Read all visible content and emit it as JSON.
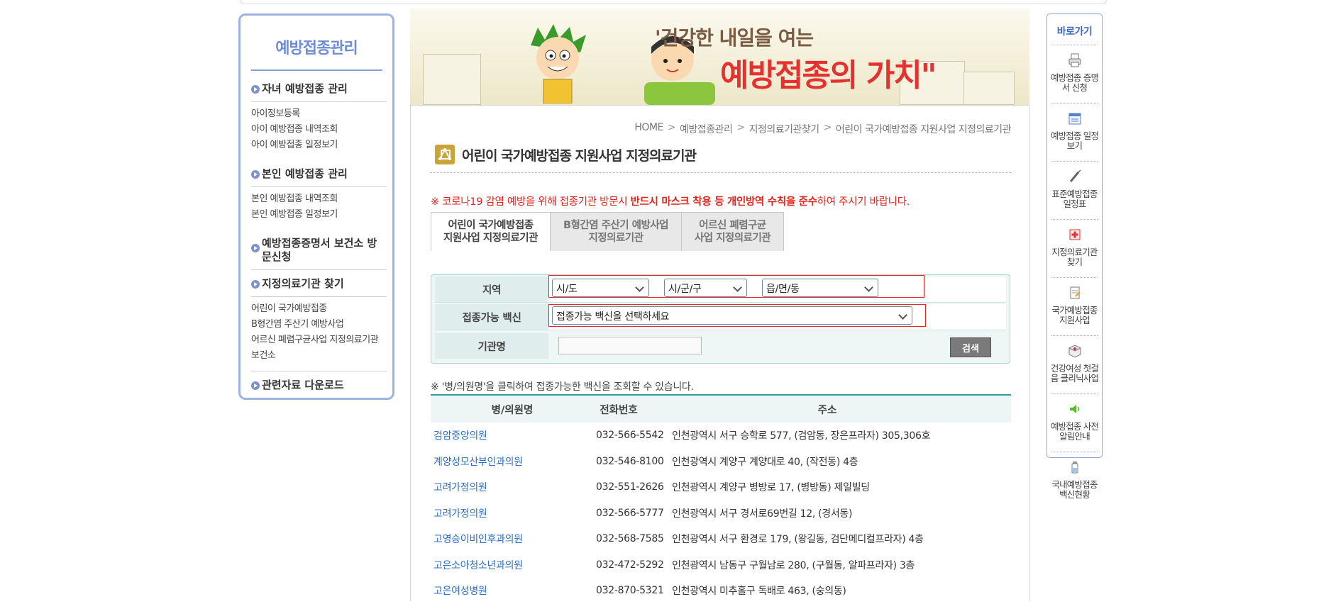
{
  "leftnav": {
    "title": "예방접종관리",
    "sections": [
      {
        "title": "자녀 예방접종 관리",
        "items": [
          "아이정보등록",
          "아이 예방접종 내역조회",
          "아이 예방접종 일정보기"
        ]
      },
      {
        "title": "본인 예방접종 관리",
        "items": [
          "본인 예방접종 내역조회",
          "본인 예방접종 일정보기"
        ]
      },
      {
        "title": "예방접종증명서 보건소 방문신청",
        "items": []
      },
      {
        "title": "지정의료기관 찾기",
        "items": [
          "어린이 국가예방접종",
          "B형간염 주산기 예방사업",
          "어르신 폐렴구균사업 지정의료기관",
          "보건소"
        ]
      },
      {
        "title": "관련자료 다운로드",
        "items": []
      }
    ]
  },
  "banner": {
    "slogan_line1": "'건강한 내일을 여는",
    "slogan_line2": "예방접종의 가치\""
  },
  "breadcrumb": [
    "HOME",
    "예방접종관리",
    "지정의료기관찾기",
    "어린이 국가예방접종 지원사업 지정의료기관"
  ],
  "page_title": "어린이 국가예방접종 지원사업 지정의료기관",
  "notice": {
    "part1": "※ 코로나19 감염 예방을 위해 접종기관 방문시 ",
    "bold": "반드시 마스크 착용 등 개인방역 수칙을 준수",
    "part2": "하여 주시기 바랍니다."
  },
  "tabs": [
    {
      "line1": "어린이 국가예방접종",
      "line2": "지원사업 지정의료기관",
      "active": true
    },
    {
      "line1": "B형간염 주산기 예방사업",
      "line2": "지정의료기관",
      "active": false
    },
    {
      "line1": "어르신 폐렴구균",
      "line2": "사업 지정의료기관",
      "active": false
    }
  ],
  "search": {
    "region_label": "지역",
    "sido_value": "시/도",
    "sigungu_value": "시/군/구",
    "eupmyeondong_value": "읍/면/동",
    "vaccine_label": "접종가능 백신",
    "vaccine_value": "접종가능 백신을 선택하세요",
    "institution_label": "기관명",
    "institution_value": "",
    "search_button": "검색"
  },
  "hint": "※ '병/의원명'을 클릭하여 접종가능한 백신을 조회할 수 있습니다.",
  "results": {
    "columns": [
      "병/의원명",
      "전화번호",
      "주소"
    ],
    "rows": [
      [
        "검암중앙의원",
        "032-566-5542",
        "인천광역시 서구 승학로 577, (검암동, 장은프라자) 305,306호"
      ],
      [
        "계양성모산부인과의원",
        "032-546-8100",
        "인천광역시 계양구 계양대로 40, (작전동) 4층"
      ],
      [
        "고려가정의원",
        "032-551-2626",
        "인천광역시 계양구 병방로 17, (병방동) 제일빌딩"
      ],
      [
        "고려가정의원",
        "032-566-5777",
        "인천광역시 서구 경서로69번길 12, (경서동)"
      ],
      [
        "고영승이비인후과의원",
        "032-568-7585",
        "인천광역시 서구 환경로 179, (왕길동, 검단메디컬프라자) 4층"
      ],
      [
        "고은소아청소년과의원",
        "032-472-5292",
        "인천광역시 남동구 구월남로 280, (구월동, 알파프라자) 3층"
      ],
      [
        "고은여성병원",
        "032-870-5321",
        "인천광역시 미추홀구 독배로 463, (숭의동)"
      ]
    ]
  },
  "rightnav": {
    "title": "바로가기",
    "items": [
      {
        "label": "예방접종 증명서 신청",
        "icon": "printer-icon"
      },
      {
        "label": "예방접종 일정보기",
        "icon": "calendar-icon"
      },
      {
        "label": "표준예방접종 일정표",
        "icon": "syringe-icon"
      },
      {
        "label": "지정의료기관 찾기",
        "icon": "hospital-icon"
      },
      {
        "label": "국가예방접종 지원사업",
        "icon": "document-icon"
      },
      {
        "label": "건강여성 첫걸음 클리닉사업",
        "icon": "package-icon"
      },
      {
        "label": "예방접종 사전알림안내",
        "icon": "speaker-icon"
      },
      {
        "label": "국내예방접종 백신현황",
        "icon": "vaccine-vial-icon"
      }
    ]
  },
  "colors": {
    "accent_blue": "#9fb3e0",
    "notice_red": "#e2231a",
    "table_rule": "#2f9e97",
    "link_blue": "#2c6fc2",
    "title_icon": "#c9a437"
  }
}
